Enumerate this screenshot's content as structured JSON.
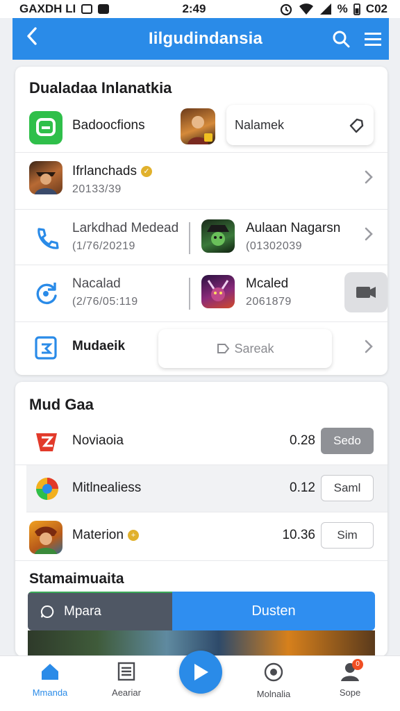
{
  "status_bar": {
    "left_text": "GAXDH LI",
    "time": "2:49",
    "battery_text": "%",
    "right_text": "C02"
  },
  "app_bar": {
    "title": "Iilgudindansia"
  },
  "section1": {
    "title": "Dualadaa Inlanatkia",
    "row1": {
      "name": "Badoocfions",
      "pill_text": "Nalamek"
    },
    "row2": {
      "name": "Ifrlanchads",
      "sub": "20133/39"
    },
    "row3": {
      "left_name": "Larkdhad Medead",
      "left_sub": "(1/76/20219",
      "right_name": "Aulaan Nagarsn",
      "right_sub": "(01302039"
    },
    "row4": {
      "left_name": "Nacalad",
      "left_sub": "(2/76/05:119",
      "right_name": "Mcaled",
      "right_sub": "2061879"
    },
    "row5": {
      "name": "Mudaeik",
      "search_placeholder": "Sareak"
    }
  },
  "section2": {
    "title": "Mud Gaa",
    "items": [
      {
        "name": "Noviaoia",
        "value": "0.28",
        "button": "Sedo"
      },
      {
        "name": "Mitlnealiess",
        "value": "0.12",
        "button": "Saml"
      },
      {
        "name": "Materion",
        "value": "10.36",
        "button": "Sim"
      }
    ],
    "subheading": "Stamaimuaita",
    "segment_left": "Mpara",
    "segment_right": "Dusten"
  },
  "bottom_nav": [
    {
      "label": "Mmanda"
    },
    {
      "label": "Aeariar"
    },
    {
      "label": "Molnalia"
    },
    {
      "label": "Sope"
    }
  ],
  "notification_count": "0",
  "colors": {
    "accent": "#2a8be8",
    "background": "#eef0f3",
    "gold": "#e1b12c"
  }
}
